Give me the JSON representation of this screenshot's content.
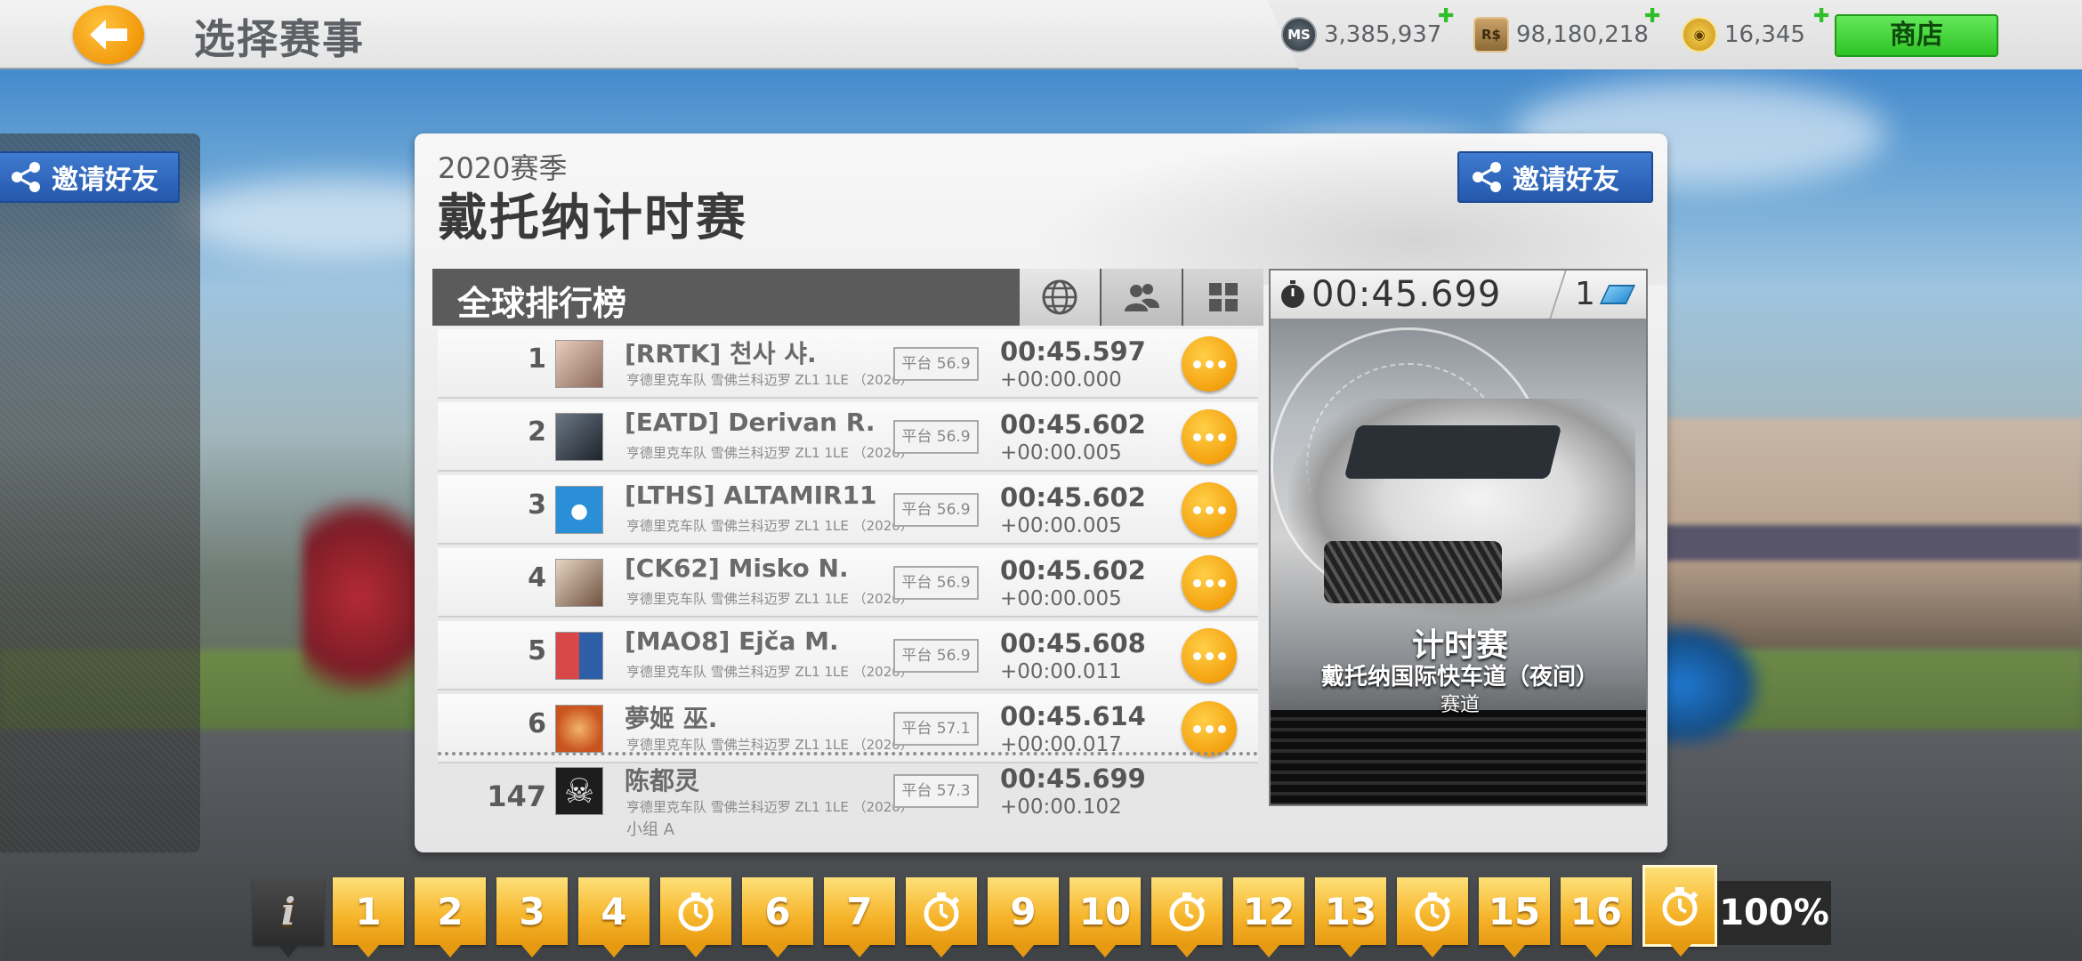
{
  "topbar": {
    "title": "选择赛事",
    "currencies": {
      "ms": {
        "icon": "ms-coin-icon",
        "label": "MS",
        "value": "3,385,937"
      },
      "rs": {
        "icon": "rs-cash-icon",
        "label": "R$",
        "value": "98,180,218"
      },
      "gold": {
        "icon": "gold-coin-icon",
        "value": "16,345"
      }
    },
    "shop_label": "商店"
  },
  "left_panel": {
    "invite_label": "邀请好友"
  },
  "event": {
    "season": "2020赛季",
    "title": "戴托纳计时赛",
    "invite_label": "邀请好友"
  },
  "leaderboard": {
    "title": "全球排行榜",
    "tabs": [
      {
        "icon": "globe-icon",
        "active": true
      },
      {
        "icon": "friends-icon",
        "active": false
      },
      {
        "icon": "grid-icon",
        "active": false
      }
    ],
    "rows": [
      {
        "rank": "1",
        "name": "[RRTK] 천사 샤.",
        "car": "亨德里克车队 雪佛兰科迈罗 ZL1 1LE （2020）",
        "pf": "平台 56.9",
        "time": "00:45.597",
        "gap": "+00:00.000",
        "avatar_color": "#b9968a"
      },
      {
        "rank": "2",
        "name": "[EATD] Derivan R.",
        "car": "亨德里克车队 雪佛兰科迈罗 ZL1 1LE （2020）",
        "pf": "平台 56.9",
        "time": "00:45.602",
        "gap": "+00:00.005",
        "avatar_color": "#3b4450"
      },
      {
        "rank": "3",
        "name": "[LTHS] ALTAMIR11",
        "car": "亨德里克车队 雪佛兰科迈罗 ZL1 1LE （2020）",
        "pf": "平台 56.9",
        "time": "00:45.602",
        "gap": "+00:00.005",
        "avatar_color": "#2a8fd6"
      },
      {
        "rank": "4",
        "name": "[CK62] Misko N.",
        "car": "亨德里克车队 雪佛兰科迈罗 ZL1 1LE （2020）",
        "pf": "平台 56.9",
        "time": "00:45.602",
        "gap": "+00:00.005",
        "avatar_color": "#a07c62"
      },
      {
        "rank": "5",
        "name": "[MAO8] Ejča M.",
        "car": "亨德里克车队 雪佛兰科迈罗 ZL1 1LE （2020）",
        "pf": "平台 56.9",
        "time": "00:45.608",
        "gap": "+00:00.011",
        "avatar_color": "#b33a3a"
      },
      {
        "rank": "6",
        "name": "夢姬 巫.",
        "car": "亨德里克车队 雪佛兰科迈罗 ZL1 1LE （2020）",
        "pf": "平台 57.1",
        "time": "00:45.614",
        "gap": "+00:00.017",
        "avatar_color": "#e08a3c"
      }
    ],
    "me": {
      "rank": "147",
      "name": "陈都灵",
      "car": "亨德里克车队 雪佛兰科迈罗 ZL1 1LE （2020）",
      "group": "小组 A",
      "pf": "平台 57.3",
      "time": "00:45.699",
      "gap": "+00:00.102",
      "avatar_icon": "skull-icon"
    }
  },
  "event_card": {
    "best_time": "00:45.699",
    "count": "1",
    "line1": "计时赛",
    "line2": "戴托纳国际快车道（夜间）",
    "line3": "赛道"
  },
  "progress": {
    "info_label": "i",
    "stages": [
      {
        "label": "1",
        "type": "num"
      },
      {
        "label": "2",
        "type": "num"
      },
      {
        "label": "3",
        "type": "num"
      },
      {
        "label": "4",
        "type": "num"
      },
      {
        "label": "",
        "type": "timer"
      },
      {
        "label": "6",
        "type": "num"
      },
      {
        "label": "7",
        "type": "num"
      },
      {
        "label": "",
        "type": "timer"
      },
      {
        "label": "9",
        "type": "num"
      },
      {
        "label": "10",
        "type": "num"
      },
      {
        "label": "",
        "type": "timer"
      },
      {
        "label": "12",
        "type": "num"
      },
      {
        "label": "13",
        "type": "num"
      },
      {
        "label": "",
        "type": "timer"
      },
      {
        "label": "15",
        "type": "num"
      },
      {
        "label": "16",
        "type": "num"
      },
      {
        "label": "",
        "type": "timer-current"
      }
    ],
    "percent": "100%"
  }
}
